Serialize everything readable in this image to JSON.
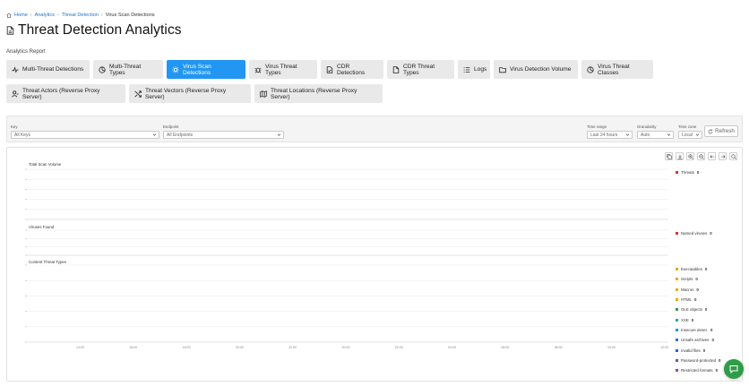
{
  "breadcrumb": {
    "home": "Home",
    "analytics": "Analytics",
    "threat_detection": "Threat Detection",
    "current": "Virus Scan Detections"
  },
  "page": {
    "title": "Threat Detection Analytics",
    "section_label": "Analytics Report"
  },
  "tabs": [
    {
      "label": "Multi-Threat Detections",
      "icon": "activity-icon",
      "active": false
    },
    {
      "label": "Multi-Threat Types",
      "icon": "pie-icon",
      "active": false
    },
    {
      "label": "Virus Scan Detections",
      "icon": "gear-icon",
      "active": true
    },
    {
      "label": "Virus Threat Types",
      "icon": "bug-icon",
      "active": false
    },
    {
      "label": "CDR Detections",
      "icon": "file-check-icon",
      "active": false
    },
    {
      "label": "CDR Threat Types",
      "icon": "file-icon",
      "active": false
    },
    {
      "label": "Logs",
      "icon": "list-icon",
      "active": false
    },
    {
      "label": "Virus Detection Volume",
      "icon": "folder-icon",
      "active": false
    },
    {
      "label": "Virus Threat Classes",
      "icon": "pie-icon",
      "active": false
    },
    {
      "label": "Threat Actors (Reverse Proxy Server)",
      "icon": "user-icon",
      "active": false
    },
    {
      "label": "Threat Vectors (Reverse Proxy Server)",
      "icon": "shuffle-icon",
      "active": false
    },
    {
      "label": "Threat Locations (Reverse Proxy Server)",
      "icon": "map-icon",
      "active": false
    }
  ],
  "filters": {
    "key_label": "Key",
    "key_value": "All Keys",
    "endpoint_label": "Endpoint",
    "endpoint_value": "All Endpoints",
    "time_range_label": "Time range",
    "time_range_value": "Last 24 hours",
    "granularity_label": "Granularity",
    "granularity_value": "Auto",
    "timezone_label": "Time zone",
    "timezone_value": "Local",
    "refresh_label": "Refresh"
  },
  "chart_data": [
    {
      "type": "line",
      "title": "Total Scan Volume",
      "x": [
        "14:00",
        "16:00",
        "18:00",
        "20:00",
        "22:00",
        "00:00",
        "02:00",
        "04:00",
        "06:00",
        "08:00",
        "10:00",
        "12:00"
      ],
      "series": [
        {
          "name": "Threats",
          "values": [
            0,
            0,
            0,
            0,
            0,
            0,
            0,
            0,
            0,
            0,
            0,
            0
          ],
          "color": "#d9342b",
          "total": "0"
        }
      ]
    },
    {
      "type": "line",
      "title": "Viruses Found",
      "x": [
        "14:00",
        "16:00",
        "18:00",
        "20:00",
        "22:00",
        "00:00",
        "02:00",
        "04:00",
        "06:00",
        "08:00",
        "10:00",
        "12:00"
      ],
      "series": [
        {
          "name": "Named viruses",
          "values": [
            0,
            0,
            0,
            0,
            0,
            0,
            0,
            0,
            0,
            0,
            0,
            0
          ],
          "color": "#d9342b",
          "total": "0"
        }
      ]
    },
    {
      "type": "line",
      "title": "Content Threat Types",
      "x": [
        "14:00",
        "16:00",
        "18:00",
        "20:00",
        "22:00",
        "00:00",
        "02:00",
        "04:00",
        "06:00",
        "08:00",
        "10:00",
        "12:00"
      ],
      "series": [
        {
          "name": "Executables",
          "color": "#f0a800",
          "total": "0"
        },
        {
          "name": "Scripts",
          "color": "#f0a800",
          "total": "0"
        },
        {
          "name": "Macros",
          "color": "#f0a800",
          "total": "0"
        },
        {
          "name": "HTML",
          "color": "#f0a800",
          "total": "0"
        },
        {
          "name": "OLE objects",
          "color": "#2e9c48",
          "total": "0"
        },
        {
          "name": "XXE",
          "color": "#2aa9a0",
          "total": "0"
        },
        {
          "name": "Insecure deser.",
          "color": "#2a8fd6",
          "total": "0"
        },
        {
          "name": "Unsafe archives",
          "color": "#2a6fd6",
          "total": "0"
        },
        {
          "name": "Invalid files",
          "color": "#2a5fd6",
          "total": "0"
        },
        {
          "name": "Password-protected",
          "color": "#6a4fc8",
          "total": "0"
        },
        {
          "name": "Restricted formats",
          "color": "#9a3fc8",
          "total": "0"
        }
      ]
    }
  ]
}
